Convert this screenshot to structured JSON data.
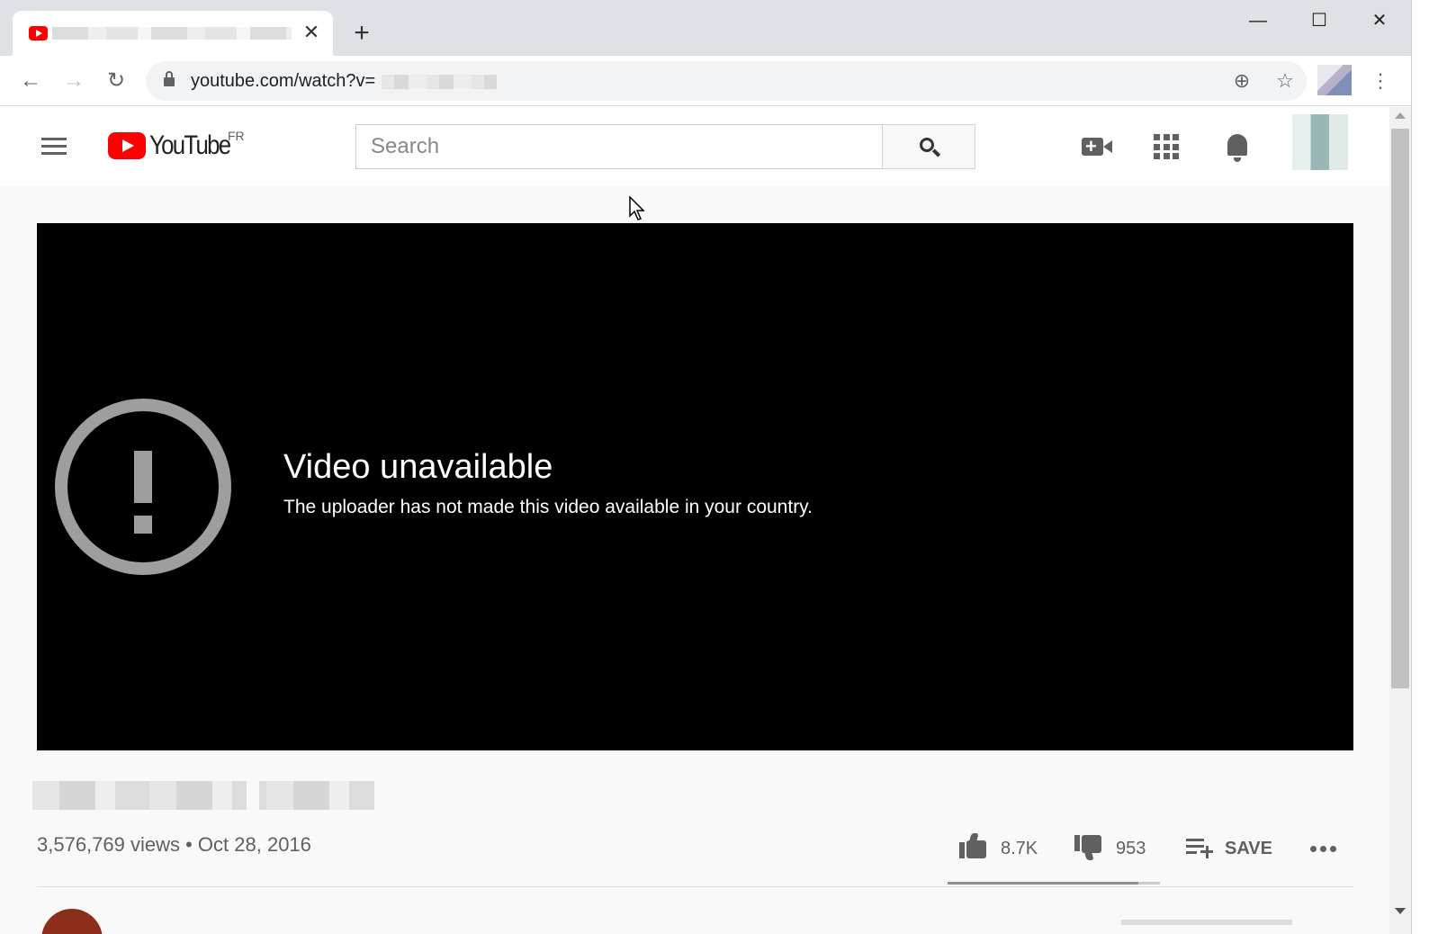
{
  "browser": {
    "tab": {
      "close_glyph": "✕",
      "favicon": "youtube-favicon"
    },
    "new_tab_glyph": "+",
    "window_controls": {
      "minimize": "—",
      "maximize": "☐",
      "close": "✕"
    },
    "nav": {
      "back": "←",
      "forward": "→",
      "reload": "↻"
    },
    "omnibox": {
      "url": "youtube.com/watch?v="
    },
    "icons": {
      "zoom": "⊕",
      "bookmark": "☆",
      "menu": "⋮"
    }
  },
  "youtube": {
    "logo_text": "YouTube",
    "country_code": "FR",
    "search": {
      "placeholder": "Search"
    },
    "header_icons": [
      "create-video-icon",
      "apps-icon",
      "notifications-icon",
      "account-avatar"
    ]
  },
  "player": {
    "error_title": "Video unavailable",
    "error_message": "The uploader has not made this video available in your country."
  },
  "video_info": {
    "views_date": "3,576,769 views • Oct 28, 2016",
    "likes": "8.7K",
    "dislikes": "953",
    "save_label": "SAVE",
    "like_ratio": 0.9
  },
  "colors": {
    "brand_red": "#ff0000",
    "player_bg": "#000000",
    "icon_gray": "#606060",
    "page_bg": "#f9f9f9"
  }
}
